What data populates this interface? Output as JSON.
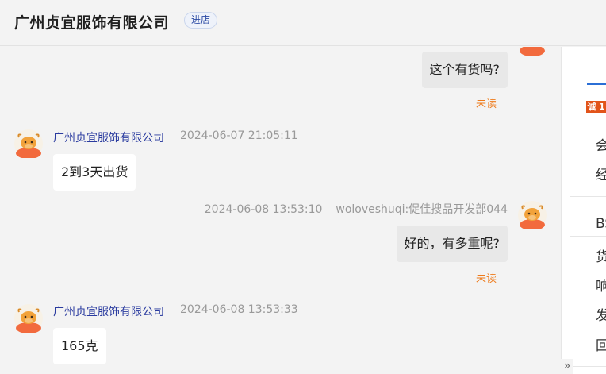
{
  "header": {
    "title": "广州贞宜服饰有限公司",
    "enter_shop": "进店"
  },
  "messages": [
    {
      "direction": "out",
      "text": "这个有货吗?",
      "status": "未读"
    },
    {
      "direction": "in",
      "sender": "广州贞宜服饰有限公司",
      "time": "2024-06-07 21:05:11",
      "text": "2到3天出货"
    },
    {
      "direction": "out",
      "sender": "woloveshuqi:促佳搜品开发部044",
      "time": "2024-06-08 13:53:10",
      "text": "好的，有多重呢?",
      "status": "未读"
    },
    {
      "direction": "in",
      "sender": "广州贞宜服饰有限公司",
      "time": "2024-06-08 13:53:33",
      "text": "165克"
    }
  ],
  "right_panel": {
    "badge_cheng": "诚",
    "badge_num": "1",
    "lines": [
      "会",
      "经",
      "BS",
      "货",
      "响",
      "发",
      "回"
    ]
  },
  "icons": {
    "avatar": "yak-avatar-icon",
    "collapse": "double-chevron-right-icon"
  },
  "colors": {
    "sender_name": "#2a3b9f",
    "unread": "#ee7a1a",
    "accent": "#2b6fd6",
    "avatar_orange": "#f26a3d"
  }
}
